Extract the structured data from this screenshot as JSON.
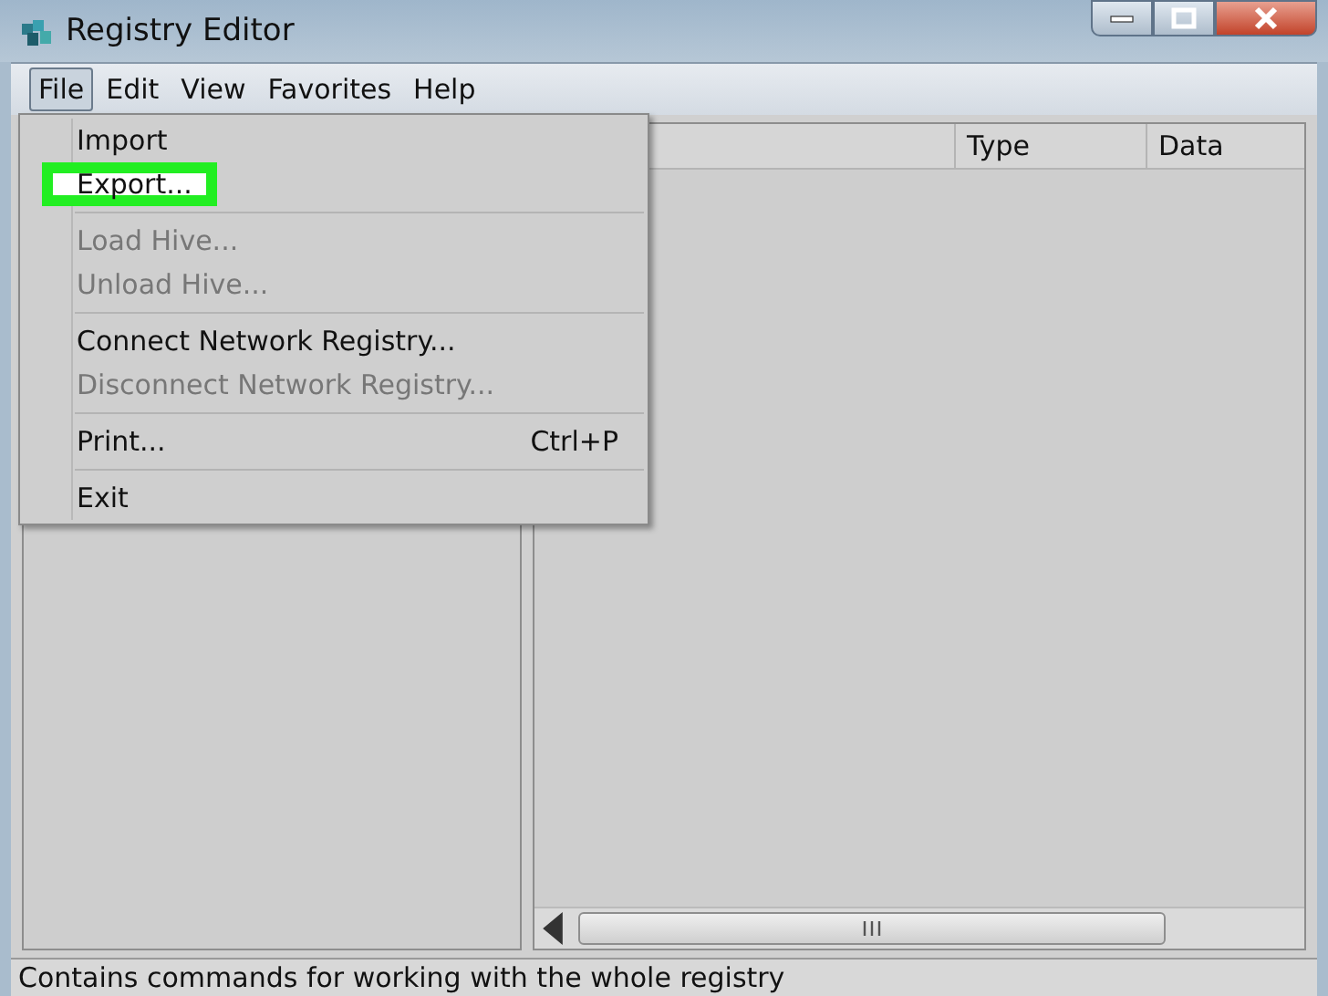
{
  "window": {
    "title": "Registry Editor"
  },
  "menu_bar": [
    {
      "label": "File",
      "selected": true
    },
    {
      "label": "Edit",
      "selected": false
    },
    {
      "label": "View",
      "selected": false
    },
    {
      "label": "Favorites",
      "selected": false
    },
    {
      "label": "Help",
      "selected": false
    }
  ],
  "file_menu": [
    {
      "kind": "item",
      "label": "Import",
      "disabled": false,
      "selected": false
    },
    {
      "kind": "item",
      "label": "Export...",
      "disabled": false,
      "selected": true
    },
    {
      "kind": "separator"
    },
    {
      "kind": "item",
      "label": "Load Hive...",
      "disabled": true,
      "selected": false
    },
    {
      "kind": "item",
      "label": "Unload Hive...",
      "disabled": true,
      "selected": false
    },
    {
      "kind": "separator"
    },
    {
      "kind": "item",
      "label": "Connect Network Registry...",
      "disabled": false,
      "selected": false
    },
    {
      "kind": "item",
      "label": "Disconnect Network Registry...",
      "disabled": true,
      "selected": false
    },
    {
      "kind": "separator"
    },
    {
      "kind": "item",
      "label": "Print...",
      "shortcut": "Ctrl+P",
      "disabled": false,
      "selected": false
    },
    {
      "kind": "separator"
    },
    {
      "kind": "item",
      "label": "Exit",
      "disabled": false,
      "selected": false
    }
  ],
  "table": {
    "columns": [
      "Type",
      "Data"
    ]
  },
  "status_bar": "Contains commands for working with the whole registry"
}
